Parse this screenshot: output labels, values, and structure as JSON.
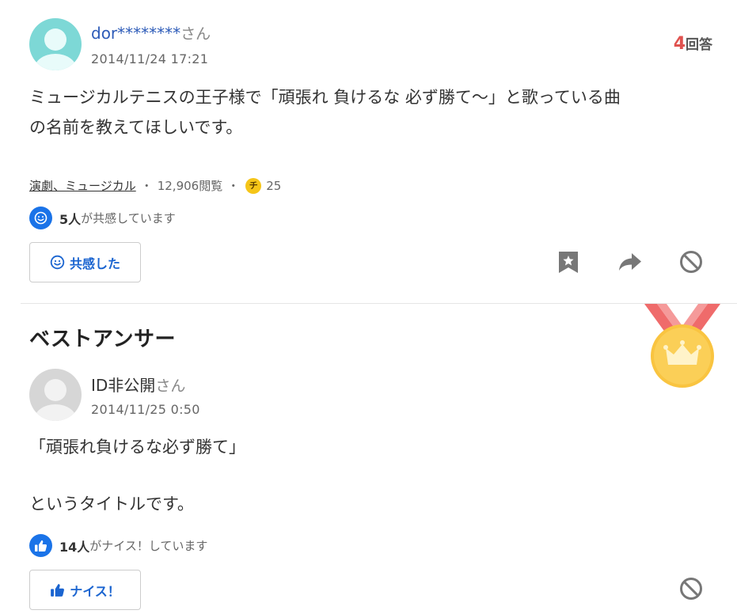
{
  "question": {
    "username": "dor********",
    "honorific": "さん",
    "timestamp": "2014/11/24 17:21",
    "answer_count": "4",
    "answer_count_label": "回答",
    "body_line1": "ミュージカルテニスの王子様で「頑張れ 負けるな 必ず勝て～」と歌っている曲",
    "body_line2": "の名前を教えてほしいです。",
    "category": "演劇、ミュージカル",
    "separator": "・",
    "views": "12,906閲覧",
    "coin_symbol": "チ",
    "coins": "25",
    "empathy_count": "5人",
    "empathy_text": "が共感しています",
    "empathy_button_label": "共感した",
    "icons": [
      "smile-icon",
      "bookmark-star-icon",
      "share-arrow-icon",
      "block-icon"
    ]
  },
  "best_answer": {
    "section_title": "ベストアンサー",
    "username": "ID非公開",
    "honorific": "さん",
    "timestamp": "2014/11/25 0:50",
    "body_line1": "「頑張れ負けるな必ず勝て」",
    "body_line2": "というタイトルです。",
    "nice_count": "14人",
    "nice_text": "がナイス！しています",
    "nice_button_label": "ナイス！",
    "icons": [
      "medal-crown-icon",
      "thumbs-up-icon",
      "block-icon"
    ]
  },
  "colors": {
    "link_blue": "#2d5bb8",
    "accent_blue": "#1a73e8",
    "answer_count_red": "#e0524f",
    "medal_gold": "#f9c440",
    "medal_ribbon": "#ef6b6b"
  }
}
